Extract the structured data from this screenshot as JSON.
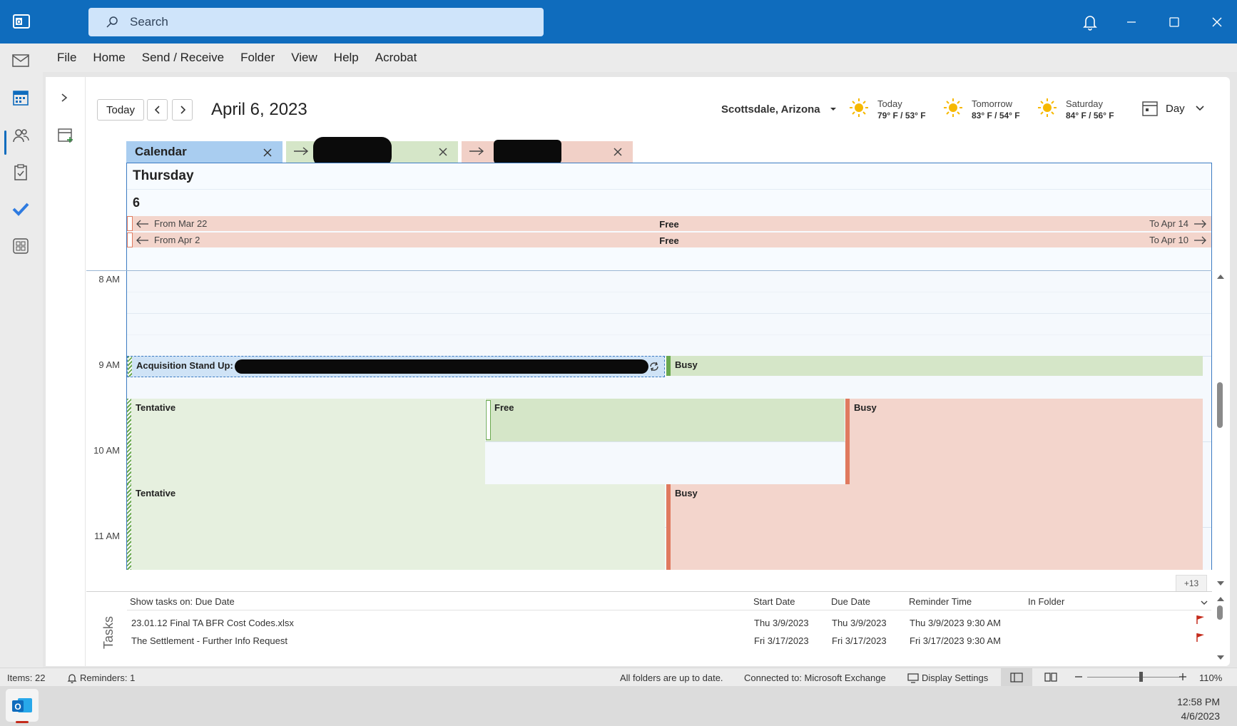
{
  "titlebar": {
    "search_placeholder": "Search"
  },
  "menu": [
    "File",
    "Home",
    "Send / Receive",
    "Folder",
    "View",
    "Help",
    "Acrobat"
  ],
  "toolbar": {
    "today_label": "Today",
    "date_title": "April 6, 2023",
    "location": "Scottsdale, Arizona",
    "weather": [
      {
        "label": "Today",
        "temp": "79° F / 53° F"
      },
      {
        "label": "Tomorrow",
        "temp": "83° F / 54° F"
      },
      {
        "label": "Saturday",
        "temp": "84° F / 56° F"
      }
    ],
    "view_label": "Day"
  },
  "tabs": {
    "main_label": "Calendar"
  },
  "day": {
    "name": "Thursday",
    "number": "6",
    "allday": [
      {
        "from": "From Mar 22",
        "status": "Free",
        "to": "To Apr 14"
      },
      {
        "from": "From Apr 2",
        "status": "Free",
        "to": "To Apr 10"
      }
    ]
  },
  "times": [
    "8 AM",
    "9 AM",
    "10 AM",
    "11 AM"
  ],
  "appointments": {
    "standup": "Acquisition Stand Up:",
    "busy1": "Busy",
    "tentative1": "Tentative",
    "free1": "Free",
    "busy2": "Busy",
    "tentative2": "Tentative",
    "busy3": "Busy",
    "more": "+13"
  },
  "tasks": {
    "label": "Tasks",
    "headers": {
      "subject": "Show tasks on: Due Date",
      "start": "Start Date",
      "due": "Due Date",
      "reminder": "Reminder Time",
      "folder": "In Folder"
    },
    "rows": [
      {
        "subject": "23.01.12 Final TA BFR Cost Codes.xlsx",
        "start": "Thu 3/9/2023",
        "due": "Thu 3/9/2023",
        "reminder": "Thu 3/9/2023 9:30 AM"
      },
      {
        "subject": "The Settlement - Further Info Request",
        "start": "Fri 3/17/2023",
        "due": "Fri 3/17/2023",
        "reminder": "Fri 3/17/2023 9:30 AM"
      }
    ]
  },
  "status": {
    "items": "Items: 22",
    "reminders": "Reminders: 1",
    "sync": "All folders are up to date.",
    "connection": "Connected to: Microsoft Exchange",
    "display_settings": "Display Settings",
    "zoom": "110%"
  },
  "taskbar": {
    "time": "12:58 PM",
    "date": "4/6/2023"
  },
  "colors": {
    "accent": "#0f6cbd",
    "busy": "#f3d5cc",
    "free": "#d5e6c8",
    "calendar_tab": "#a9cdf0"
  }
}
